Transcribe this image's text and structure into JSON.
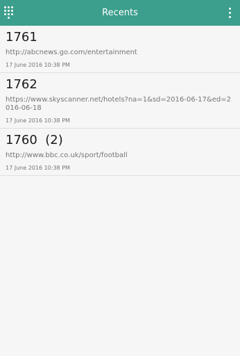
{
  "header": {
    "title": "Recents",
    "left_icon": "dialpad-grid-icon",
    "right_icon": "overflow-menu-icon",
    "accent_color": "#3c9e8c"
  },
  "recents": [
    {
      "title": "1761",
      "url": "http://abcnews.go.com/entertainment",
      "timestamp": "17 June 2016 10:38 PM"
    },
    {
      "title": "1762",
      "url": "https://www.skyscanner.net/hotels?na=1&sd=2016-06-17&ed=2016-06-18",
      "timestamp": "17 June 2016 10:38 PM"
    },
    {
      "title": "1760  (2)",
      "url": "http://www.bbc.co.uk/sport/football",
      "timestamp": "17 June 2016 10:38 PM"
    }
  ]
}
